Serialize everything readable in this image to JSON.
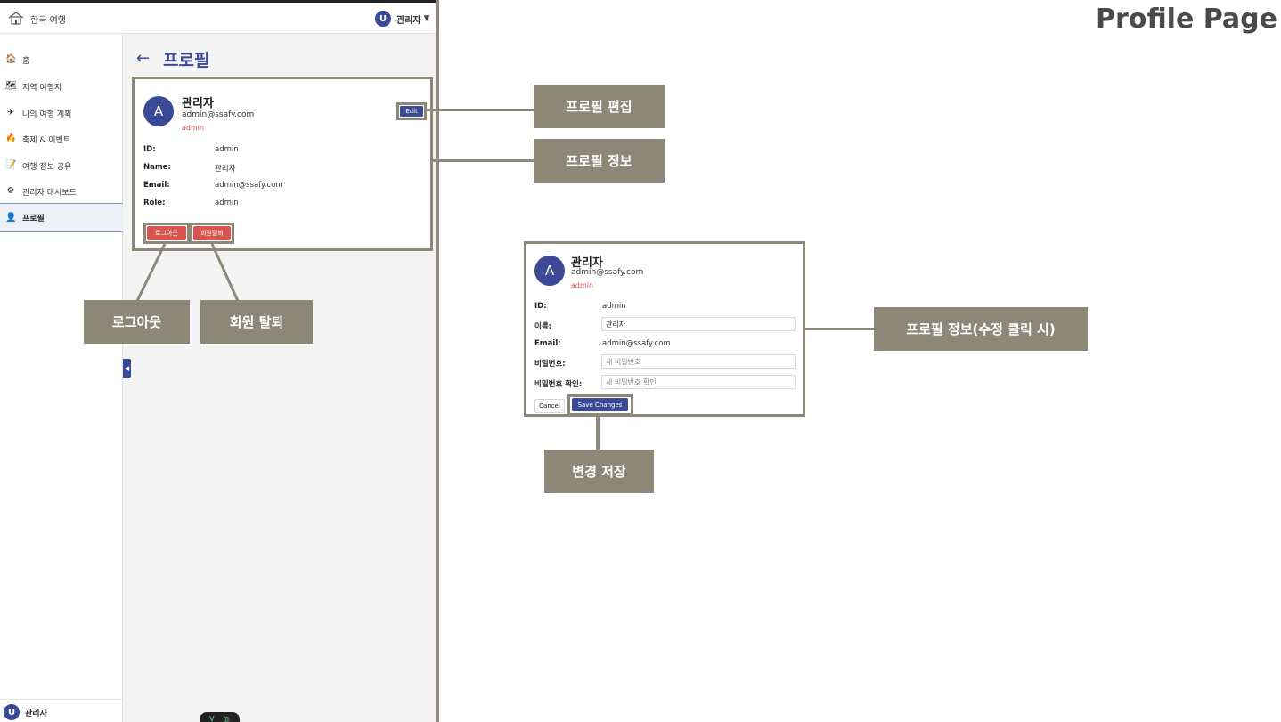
{
  "page_heading": "Profile Page",
  "app": {
    "title": "한국 여행",
    "user": {
      "initial": "U",
      "name": "관리자"
    },
    "sidebar": {
      "items": [
        {
          "icon": "home-icon",
          "glyph": "🏠",
          "label": "홈"
        },
        {
          "icon": "map-icon",
          "glyph": "🗺",
          "label": "지역 여행지"
        },
        {
          "icon": "plane-icon",
          "glyph": "✈",
          "label": "나의 여행 계획"
        },
        {
          "icon": "fire-icon",
          "glyph": "🔥",
          "label": "축제 & 이벤트"
        },
        {
          "icon": "memo-icon",
          "glyph": "📝",
          "label": "여행 정보 공유"
        },
        {
          "icon": "gear-icon",
          "glyph": "⚙",
          "label": "관리자 대시보드"
        },
        {
          "icon": "person-icon",
          "glyph": "👤",
          "label": "프로필",
          "active": true
        }
      ],
      "footer": {
        "initial": "U",
        "name": "관리자"
      }
    },
    "back_arrow": "←",
    "page_title": "프로필",
    "profile_view": {
      "avatar": "A",
      "name": "관리자",
      "email": "admin@ssafy.com",
      "role": "admin",
      "edit_label": "Edit",
      "fields": [
        {
          "key": "ID:",
          "value": "admin"
        },
        {
          "key": "Name:",
          "value": "관리자"
        },
        {
          "key": "Email:",
          "value": "admin@ssafy.com"
        },
        {
          "key": "Role:",
          "value": "admin"
        }
      ],
      "logout_label": "로그아웃",
      "withdraw_label": "회원탈퇴"
    },
    "devtools": {
      "left": "V",
      "right": "◎"
    }
  },
  "profile_edit": {
    "avatar": "A",
    "name": "관리자",
    "email": "admin@ssafy.com",
    "role": "admin",
    "id_key": "ID:",
    "id_value": "admin",
    "name_key": "이름:",
    "name_value": "관리자",
    "email_key": "Email:",
    "email_value": "admin@ssafy.com",
    "password_key": "비밀번호:",
    "password_placeholder": "새 비밀번호",
    "password_confirm_key": "비밀번호 확인:",
    "password_confirm_placeholder": "새 비밀번호 확인",
    "cancel_label": "Cancel",
    "save_label": "Save Changes"
  },
  "callouts": {
    "edit_profile": "프로필 편집",
    "profile_info": "프로필 정보",
    "logout": "로그아웃",
    "withdraw": "회원 탈퇴",
    "profile_info_edit": "프로필 정보(수정 클릭 시)",
    "save_changes": "변경 저장"
  },
  "colors": {
    "annotation": "#8d8777",
    "primary": "#3a4a96",
    "danger": "#d9534f"
  }
}
